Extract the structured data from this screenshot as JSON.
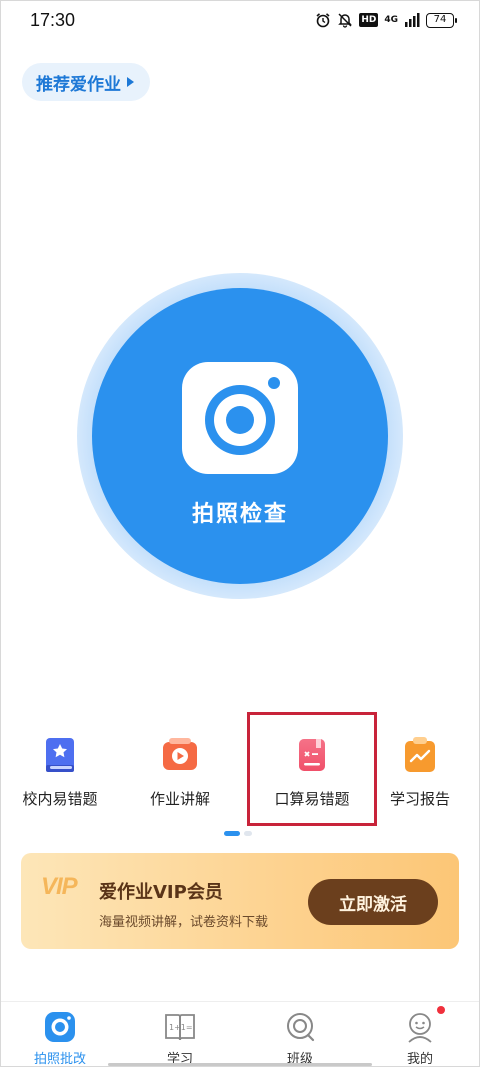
{
  "status_bar": {
    "time": "17:30",
    "hd": "HD",
    "network": "4G",
    "battery": "74",
    "icons": [
      "alarm-icon",
      "bell-off-icon",
      "hd-icon",
      "signal-icon",
      "battery-icon"
    ]
  },
  "recommend": {
    "label": "推荐爱作业"
  },
  "camera": {
    "label": "拍照检查"
  },
  "features": [
    {
      "label": "校内易错题",
      "icon": "book-star-icon",
      "color": "#4e6ff0"
    },
    {
      "label": "作业讲解",
      "icon": "video-play-icon",
      "color": "#f56a44"
    },
    {
      "label": "口算易错题",
      "icon": "calculator-book-icon",
      "color": "#f0506a"
    },
    {
      "label": "学习报告",
      "icon": "report-chart-icon",
      "color": "#f79a2e"
    }
  ],
  "vip": {
    "logo": "VIP",
    "title": "爱作业VIP会员",
    "subtitle": "海量视频讲解，试卷资料下载",
    "button": "立即激活"
  },
  "nav": [
    {
      "label": "拍照批改",
      "icon": "camera-check-icon",
      "active": true
    },
    {
      "label": "学习",
      "icon": "book-math-icon",
      "active": false
    },
    {
      "label": "班级",
      "icon": "class-icon",
      "active": false
    },
    {
      "label": "我的",
      "icon": "profile-icon",
      "active": false
    }
  ],
  "colors": {
    "accent": "#2b91ee",
    "highlight": "#c8233a",
    "vip_button": "#6b3f1d"
  }
}
